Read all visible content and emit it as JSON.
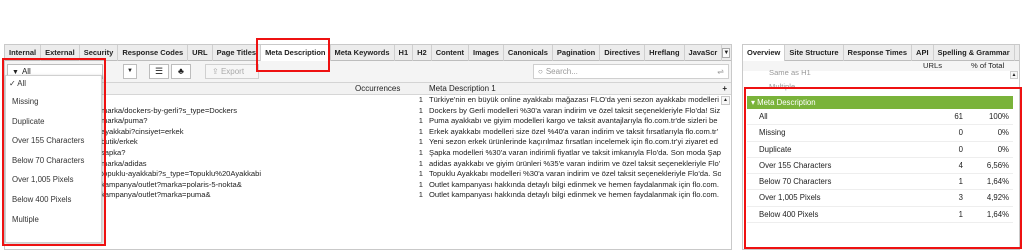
{
  "tabs": [
    "Internal",
    "External",
    "Security",
    "Response Codes",
    "URL",
    "Page Titles",
    "Meta Description",
    "Meta Keywords",
    "H1",
    "H2",
    "Content",
    "Images",
    "Canonicals",
    "Pagination",
    "Directives",
    "Hreflang",
    "JavaScr"
  ],
  "toolbar": {
    "filter_value": "All",
    "export_label": "Export",
    "search_placeholder": "Search..."
  },
  "columns": {
    "occurrences": "Occurrences",
    "meta": "Meta Description 1",
    "add": "+"
  },
  "rows": [
    {
      "address": "",
      "occ": "1",
      "meta": "Türkiye'nin en büyük online ayakkabı mağazası FLO'da yeni sezon ayakkabı modelleri v"
    },
    {
      "address": "marka/dockers-by-gerli?s_type=Dockers",
      "occ": "1",
      "meta": "Dockers by Gerli modelleri %30'a varan indirim ve özel taksit seçenekleriyle Flo'da! Siz"
    },
    {
      "address": "marka/puma?",
      "occ": "1",
      "meta": "Puma ayakkabı ve giyim modelleri kargo ve taksit avantajlarıyla flo.com.tr'de sizleri be"
    },
    {
      "address": "ayakkabi?cinsiyet=erkek",
      "occ": "1",
      "meta": "Erkek ayakkabı modelleri size özel %40'a varan indirim ve taksit fırsatlarıyla flo.com.tr'"
    },
    {
      "address": "butik/erkek",
      "occ": "1",
      "meta": "Yeni sezon erkek ürünlerinde kaçırılmaz fırsatları incelemek için flo.com.tr'yi ziyaret ed"
    },
    {
      "address": "sapka?",
      "occ": "1",
      "meta": "Şapka modelleri %30'a varan indirimli fiyatlar ve taksit imkanıyla Flo'da. Son moda Şap"
    },
    {
      "address": "marka/adidas",
      "occ": "1",
      "meta": "adidas ayakkabı ve giyim ürünleri %35'e varan indirim ve özel taksit seçenekleriyle Flo'"
    },
    {
      "address": "topuklu-ayakkabi?s_type=Topuklu%20Ayakkabi",
      "occ": "1",
      "meta": "Topuklu Ayakkabı modelleri %30'a varan indirim ve özel taksit seçenekleriyle Flo'da. So"
    },
    {
      "address": "kampanya/outlet?marka=polaris-5-nokta&",
      "occ": "1",
      "meta": "Outlet kampanyası hakkında detaylı bilgi edinmek ve hemen faydalanmak için flo.com."
    },
    {
      "address": "kampanya/outlet?marka=puma&",
      "occ": "1",
      "meta": "Outlet kampanyası hakkında detaylı bilgi edinmek ve hemen faydalanmak için flo.com."
    }
  ],
  "dropdown": [
    "✓ All",
    "Missing",
    "Duplicate",
    "Over 155 Characters",
    "Below 70 Characters",
    "Over 1,005 Pixels",
    "Below 400 Pixels",
    "Multiple"
  ],
  "right_tabs": [
    "Overview",
    "Site Structure",
    "Response Times",
    "API",
    "Spelling & Grammar"
  ],
  "right_head": {
    "urls": "URLs",
    "pct": "% of Total"
  },
  "right_cut_rows": [
    "Same as H1",
    "Multiple"
  ],
  "section_title": "Meta Description",
  "right_rows": [
    {
      "label": "All",
      "count": "61",
      "pct": "100%"
    },
    {
      "label": "Missing",
      "count": "0",
      "pct": "0%"
    },
    {
      "label": "Duplicate",
      "count": "0",
      "pct": "0%"
    },
    {
      "label": "Over 155 Characters",
      "count": "4",
      "pct": "6,56%"
    },
    {
      "label": "Below 70 Characters",
      "count": "1",
      "pct": "1,64%"
    },
    {
      "label": "Over 1,005 Pixels",
      "count": "3",
      "pct": "4,92%"
    },
    {
      "label": "Below 400 Pixels",
      "count": "1",
      "pct": "1,64%"
    }
  ],
  "accent": "#7ab33a",
  "highlight": "#ee1111"
}
